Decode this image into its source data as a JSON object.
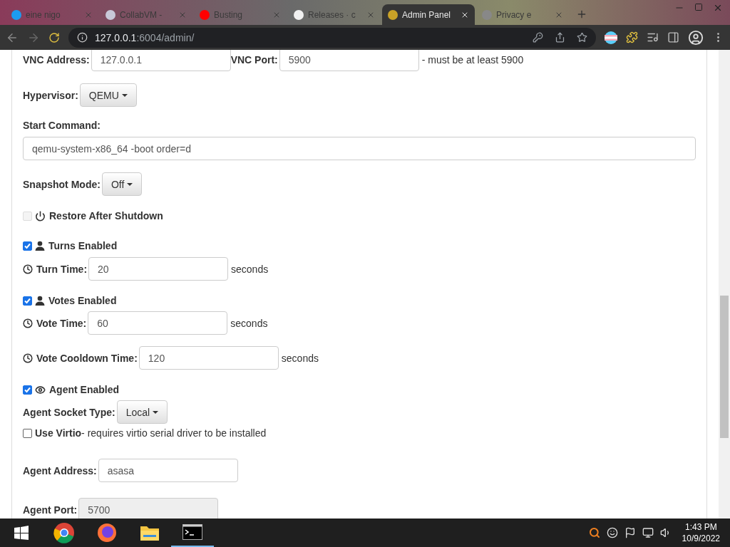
{
  "browser": {
    "tabs": [
      {
        "title": "eine nigo",
        "selected": false,
        "color": "#1d9bf0"
      },
      {
        "title": "CollabVM -",
        "selected": false,
        "color": "#c8c8d8"
      },
      {
        "title": "Busting",
        "selected": false,
        "color": "#ff0000"
      },
      {
        "title": "Releases · c",
        "selected": false,
        "color": "#f0f0f0"
      },
      {
        "title": "Admin Panel",
        "selected": true,
        "color": "#c9a227"
      },
      {
        "title": "Privacy e",
        "selected": false,
        "color": "#888888"
      }
    ],
    "address": {
      "host": "127.0.0.1",
      "path": ":6004/admin/"
    }
  },
  "form": [
    {
      "kind": "pair",
      "fields": [
        {
          "label": "VNC Address:",
          "value": "127.0.0.1"
        },
        {
          "label": "VNC Port:",
          "value": "5900"
        }
      ],
      "note": "- must be at least 5900"
    },
    {
      "kind": "select",
      "label": "Hypervisor:",
      "value": "QEMU"
    },
    {
      "kind": "wide",
      "label": "Start Command:",
      "value": "qemu-system-x86_64 -boot order=d"
    },
    {
      "kind": "select",
      "label": "Snapshot Mode:",
      "value": "Off"
    },
    {
      "kind": "check",
      "label": "Restore After Shutdown",
      "checked": false,
      "disabled": true
    },
    {
      "kind": "check",
      "label": "Turns Enabled",
      "checked": true,
      "disabled": false
    },
    {
      "kind": "input",
      "label": "Turn Time:",
      "value": "20",
      "unit": "seconds",
      "disabled": false
    },
    {
      "kind": "check",
      "label": "Votes Enabled",
      "checked": true,
      "disabled": false
    },
    {
      "kind": "input",
      "label": "Vote Time:",
      "value": "60",
      "unit": "seconds",
      "disabled": false
    },
    {
      "kind": "input",
      "label": "Vote Cooldown Time:",
      "value": "120",
      "unit": "seconds",
      "disabled": false
    },
    {
      "kind": "check",
      "label": "Agent Enabled",
      "checked": true,
      "disabled": false
    },
    {
      "kind": "select",
      "label": "Agent Socket Type:",
      "value": "Local"
    },
    {
      "kind": "check",
      "label": "Use Virtio",
      "note": "- requires virtio serial driver to be installed",
      "checked": false,
      "disabled": false
    },
    {
      "kind": "input",
      "label": "Agent Address:",
      "value": "asasa",
      "disabled": false
    },
    {
      "kind": "input",
      "label": "Agent Port:",
      "value": "5700",
      "disabled": true
    }
  ],
  "taskbar": {
    "time": "1:43 PM",
    "date": "10/9/2022"
  }
}
